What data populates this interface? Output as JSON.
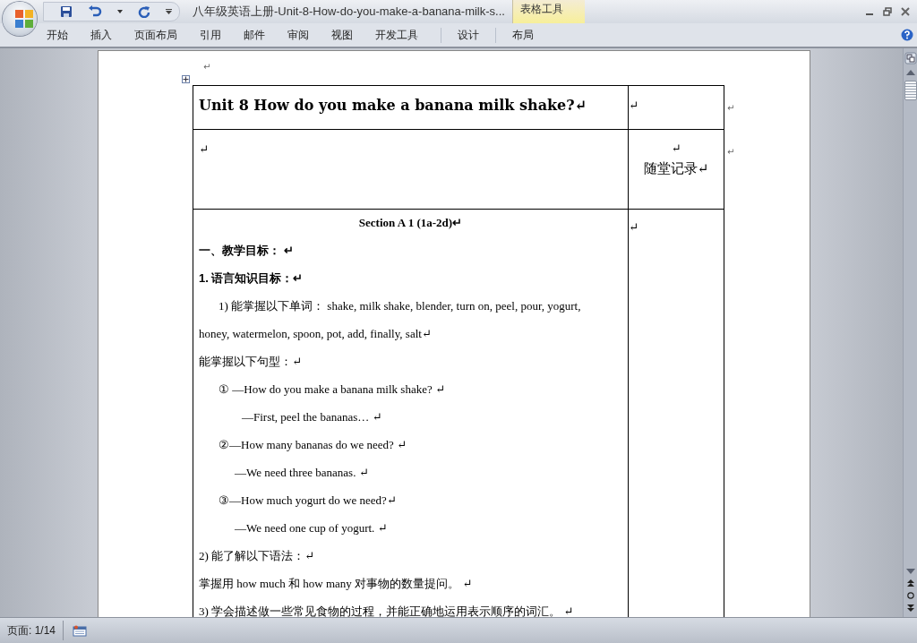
{
  "window": {
    "title": "八年级英语上册-Unit-8-How-do-you-make-a-banana-milk-s...",
    "context_label": "表格工具"
  },
  "ribbon_tabs": [
    {
      "label": "开始",
      "kind": "main"
    },
    {
      "label": "插入",
      "kind": "main"
    },
    {
      "label": "页面布局",
      "kind": "main"
    },
    {
      "label": "引用",
      "kind": "main"
    },
    {
      "label": "邮件",
      "kind": "main"
    },
    {
      "label": "审阅",
      "kind": "main"
    },
    {
      "label": "视图",
      "kind": "main"
    },
    {
      "label": "开发工具",
      "kind": "main"
    },
    {
      "label": "设计",
      "kind": "context"
    },
    {
      "label": "布局",
      "kind": "context"
    }
  ],
  "document": {
    "top_mark": "↵",
    "table": {
      "rows": [
        {
          "kind": "title",
          "end_mark": "↵",
          "cells": [
            {
              "lines": [
                {
                  "text": "Unit 8 How do you make a banana milk shake?↵",
                  "kind": "title"
                }
              ]
            },
            {
              "lines": [
                {
                  "text": "↵",
                  "kind": "plain"
                }
              ]
            }
          ]
        },
        {
          "kind": "notes",
          "end_mark": "↵",
          "cells": [
            {
              "lines": [
                {
                  "text": "↵",
                  "kind": "plain"
                }
              ]
            },
            {
              "lines": [
                {
                  "text": "↵",
                  "kind": "center"
                },
                {
                  "text": "随堂记录↵",
                  "kind": "center"
                }
              ]
            }
          ]
        },
        {
          "kind": "body",
          "end_mark": "",
          "cells": [
            {
              "lines": [
                {
                  "text": "Section A 1 (1a-2d)↵",
                  "kind": "center-bold"
                },
                {
                  "text": "一、教学目标： ↵",
                  "kind": "bold"
                },
                {
                  "text": "1. 语言知识目标：↵",
                  "kind": "bold"
                },
                {
                  "text": "1) 能掌握以下单词： shake, milk shake, blender, turn on, peel, pour, yogurt,",
                  "kind": "indent"
                },
                {
                  "text": "honey, watermelon, spoon, pot, add, finally, salt↵",
                  "kind": "plain"
                },
                {
                  "text": "能掌握以下句型：↵",
                  "kind": "plain"
                },
                {
                  "text": "①  —How do you make a banana milk shake?  ↵",
                  "kind": "indent"
                },
                {
                  "text": "—First, peel the bananas…  ↵",
                  "kind": "deep-indent"
                },
                {
                  "text": "②—How many bananas do we need? ↵",
                  "kind": "indent"
                },
                {
                  "text": "—We need three bananas.  ↵",
                  "kind": "mid-indent"
                },
                {
                  "text": "③—How much yogurt do we need?↵",
                  "kind": "indent"
                },
                {
                  "text": "—We need one cup of yogurt.  ↵",
                  "kind": "mid-indent"
                },
                {
                  "text": "2) 能了解以下语法：↵",
                  "kind": "plain"
                },
                {
                  "text": "掌握用 how much 和 how many 对事物的数量提问。 ↵",
                  "kind": "plain"
                },
                {
                  "text": "3) 学会描述做一些常见食物的过程，并能正确地运用表示顺序的词汇。 ↵",
                  "kind": "plain"
                }
              ]
            },
            {
              "lines": [
                {
                  "text": "↵",
                  "kind": "plain"
                }
              ]
            }
          ]
        }
      ]
    }
  },
  "status_bar": {
    "page": "页面: 1/14"
  }
}
